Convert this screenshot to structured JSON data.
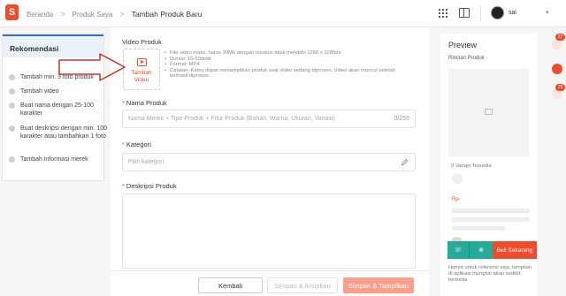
{
  "header": {
    "logo_letter": "S",
    "breadcrumbs": [
      "Beranda",
      "Produk Saya",
      "Tambah Produk Baru"
    ],
    "separator": ">",
    "username": "sai",
    "caret": "▾",
    "icons": [
      "apps-grid-icon",
      "book-icon",
      "avatar"
    ]
  },
  "recommendation": {
    "title": "Rekomendasi",
    "items": [
      "Tambah min. 3 foto produk",
      "Tambah video",
      "Buat nama dengan 25-100 karakter",
      "Buat deskripsi dengan min. 100 karakter atau tambahkan 1 foto",
      "Tambah informasi merek"
    ]
  },
  "form": {
    "video_label": "Video Produk",
    "video_button": "Tambah Video",
    "video_notes": [
      "File video maks. harus 30Mb dengan resolusi tidak melebihi 1280 x 1280px.",
      "Durasi: 10-60detik",
      "Format: MP4",
      "Catatan: Kamu dapat menampilkan produk saat video sedang diproses. Video akan muncul setelah berhasil diproses."
    ],
    "name_label": "Nama Produk",
    "name_placeholder": "Nama Merek + Tipe Produk + Fitur Produk (Bahan, Warna, Ukuran, Variasi)",
    "name_count": "0/255",
    "category_label": "Kategori",
    "category_placeholder": "Pilih kategori",
    "description_label": "Deskripsi Produk",
    "required_mark": "*"
  },
  "actions": {
    "back": "Kembali",
    "save_archive": "Simpan & Arsipkan",
    "save_publish": "Simpan & Tampilkan"
  },
  "preview": {
    "title": "Preview",
    "subtitle": "Rincian Produk",
    "variants": "0 Variasi Tersedia",
    "price": "Rp-",
    "buy_now": "Beli Sekarang",
    "note": "Hanya untuk referensi saja, tampilan di aplikasi mungkin akan sedikit berbeda."
  },
  "floating": {
    "badges": [
      "27",
      "",
      "75"
    ]
  },
  "colors": {
    "brand": "#ee4d2d",
    "teal": "#26aa99",
    "rec_header_bg": "#eaf1fb"
  }
}
